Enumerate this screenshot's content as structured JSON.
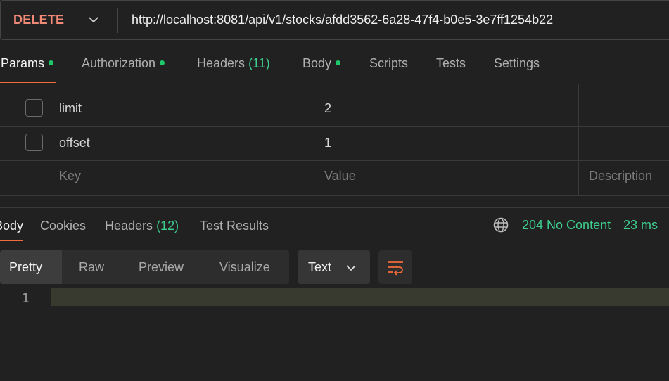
{
  "request": {
    "method": "DELETE",
    "url": "http://localhost:8081/api/v1/stocks/afdd3562-6a28-47f4-b0e5-3e7ff1254b22"
  },
  "request_tabs": [
    {
      "label": "Params",
      "dot": true,
      "count": "",
      "active": true
    },
    {
      "label": "Authorization",
      "dot": true,
      "count": "",
      "active": false
    },
    {
      "label": "Headers",
      "dot": false,
      "count": "(11)",
      "active": false
    },
    {
      "label": "Body",
      "dot": true,
      "count": "",
      "active": false
    },
    {
      "label": "Scripts",
      "dot": false,
      "count": "",
      "active": false
    },
    {
      "label": "Tests",
      "dot": false,
      "count": "",
      "active": false
    },
    {
      "label": "Settings",
      "dot": false,
      "count": "",
      "active": false
    }
  ],
  "params": {
    "rows": [
      {
        "key": "limit",
        "value": "2",
        "description": ""
      },
      {
        "key": "offset",
        "value": "1",
        "description": ""
      }
    ],
    "placeholder": {
      "key": "Key",
      "value": "Value",
      "description": "Description"
    }
  },
  "response_tabs": [
    {
      "label": "Body",
      "count": "",
      "active": true
    },
    {
      "label": "Cookies",
      "count": "",
      "active": false
    },
    {
      "label": "Headers",
      "count": "(12)",
      "active": false
    },
    {
      "label": "Test Results",
      "count": "",
      "active": false
    }
  ],
  "response": {
    "status": "204 No Content",
    "time": "23 ms"
  },
  "view_modes": [
    "Pretty",
    "Raw",
    "Preview",
    "Visualize"
  ],
  "active_view_mode": "Pretty",
  "format": "Text",
  "editor": {
    "line_numbers": [
      "1"
    ]
  },
  "colors": {
    "accent": "#f26b3a",
    "success": "#3ecf8e",
    "method": "#f08a77"
  },
  "icons": [
    "chevron-down-icon",
    "globe-icon",
    "wrap-lines-icon"
  ]
}
